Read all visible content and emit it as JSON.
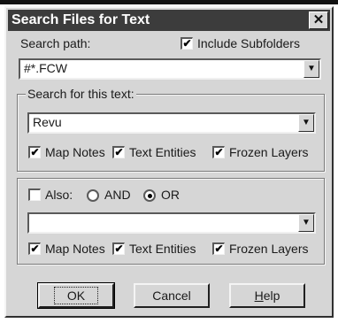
{
  "window": {
    "title": "Search Files for Text",
    "close_label": "✕"
  },
  "search_path": {
    "label": "Search path:",
    "value": "#*.FCW"
  },
  "include_subfolders": {
    "label": "Include Subfolders",
    "checked": true
  },
  "search_text_group": {
    "title": "Search for this text:",
    "value": "Revu",
    "options": [
      {
        "label": "Map Notes",
        "checked": true
      },
      {
        "label": "Text Entities",
        "checked": true
      },
      {
        "label": "Frozen Layers",
        "checked": true
      }
    ]
  },
  "also_group": {
    "also_label": "Also:",
    "also_checked": false,
    "and_label": "AND",
    "or_label": "OR",
    "selected": "OR",
    "value": "",
    "options": [
      {
        "label": "Map Notes",
        "checked": true
      },
      {
        "label": "Text Entities",
        "checked": true
      },
      {
        "label": "Frozen Layers",
        "checked": true
      }
    ]
  },
  "buttons": {
    "ok": "OK",
    "cancel": "Cancel",
    "help_prefix": "H",
    "help_rest": "elp"
  },
  "icons": {
    "check": "✔",
    "dropdown": "▼"
  }
}
